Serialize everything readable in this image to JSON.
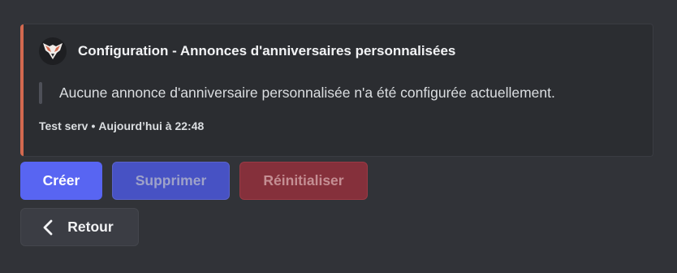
{
  "embed": {
    "accent_color": "#d3694f",
    "avatar_icon": "wolf-logo-icon",
    "title": "Configuration - Annonces d'anniversaires personnalisées",
    "description": "Aucune annonce d'anniversaire personnalisée n'a été configurée actuellement.",
    "footer": {
      "server": "Test serv",
      "separator": "•",
      "timestamp": "Aujourd’hui à 22:48"
    }
  },
  "buttons": {
    "create_label": "Créer",
    "delete_label": "Supprimer",
    "reset_label": "Réinitialiser",
    "back_label": "Retour",
    "back_icon": "chevron-left-icon"
  },
  "colors": {
    "primary": "#5865f2",
    "danger": "#85303b",
    "secondary": "#3b3d44"
  }
}
